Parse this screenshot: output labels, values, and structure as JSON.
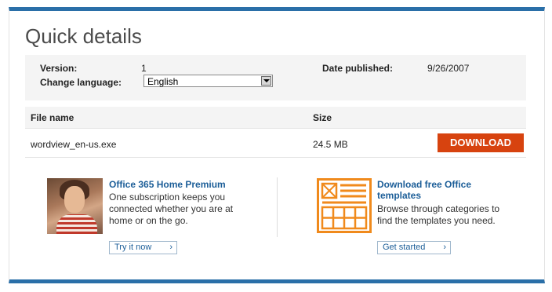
{
  "title": "Quick details",
  "details": {
    "version_label": "Version:",
    "version_value": "1",
    "date_label": "Date published:",
    "date_value": "9/26/2007",
    "language_label": "Change language:",
    "language_value": "English"
  },
  "files": {
    "col_name": "File name",
    "col_size": "Size",
    "rows": [
      {
        "name": "wordview_en-us.exe",
        "size": "24.5 MB",
        "action": "DOWNLOAD"
      }
    ]
  },
  "promos": [
    {
      "title": "Office 365 Home Premium",
      "text_lines": [
        "One subscription keeps you",
        "connected whether you are at",
        "home or on the go."
      ],
      "button": "Try it now"
    },
    {
      "title_lines": [
        "Download free Office",
        "templates"
      ],
      "text_lines": [
        "Browse through categories to",
        "find the templates you need."
      ],
      "button": "Get started"
    }
  ],
  "colors": {
    "accent": "#2a6fa8",
    "download": "#d7430f",
    "template_icon": "#f08a1c"
  }
}
